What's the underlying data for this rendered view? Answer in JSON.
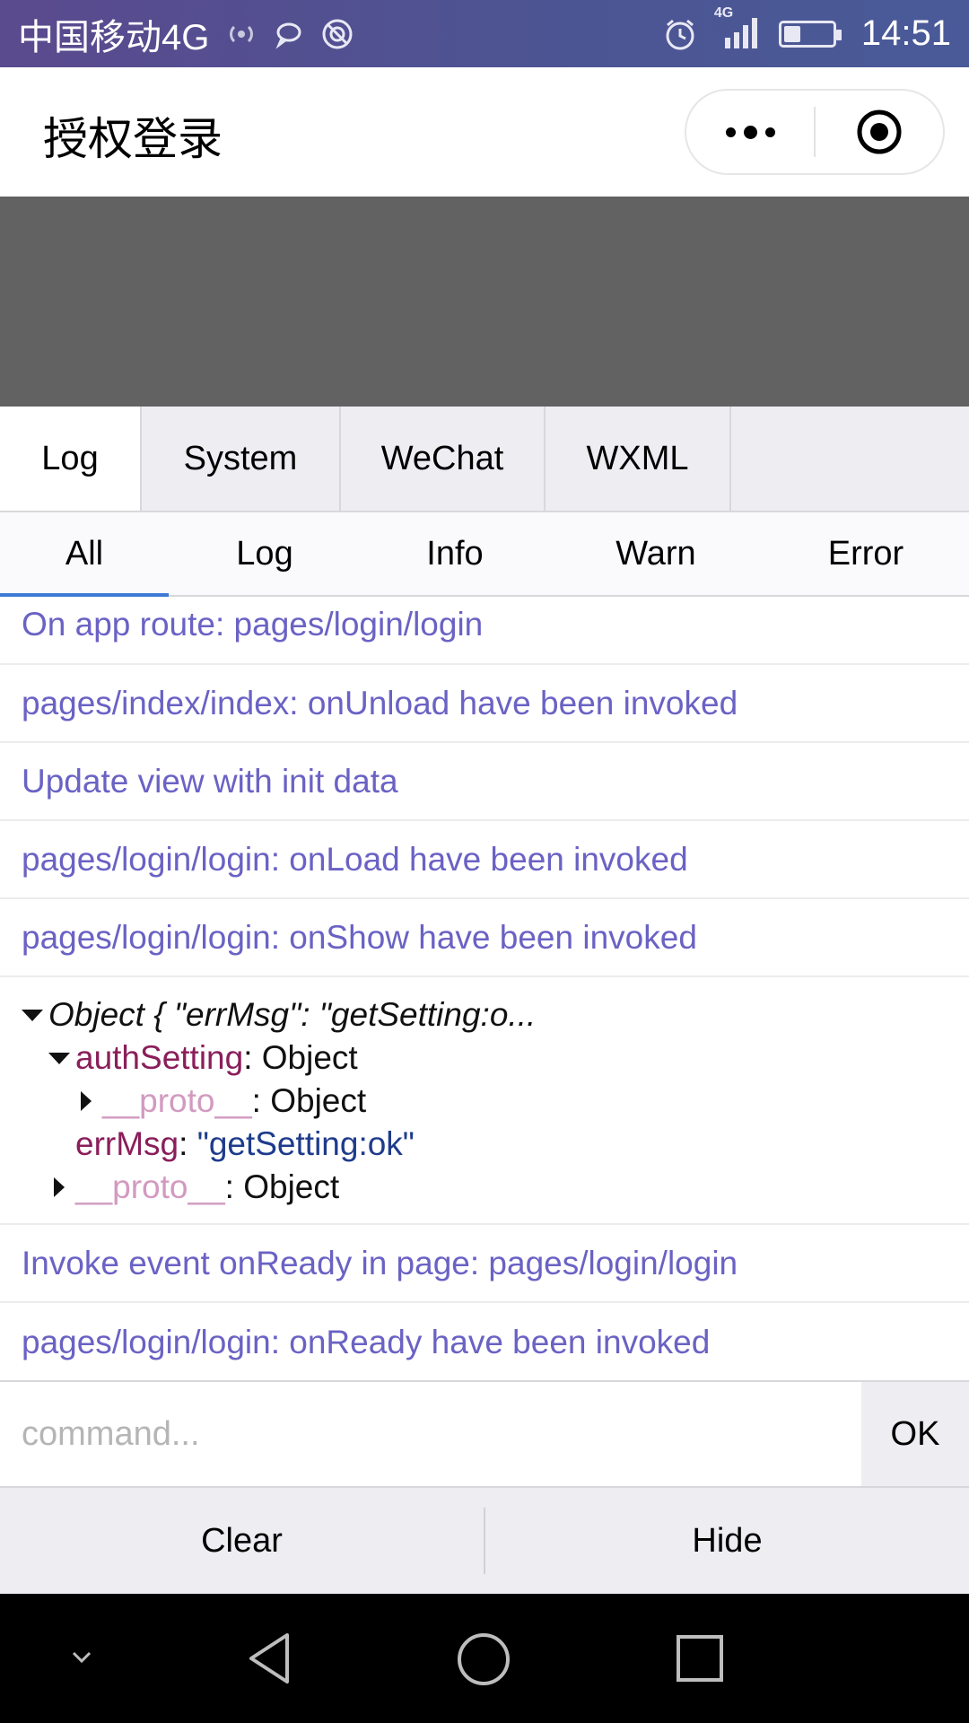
{
  "status_bar": {
    "carrier": "中国移动4G",
    "network_badge": "4G",
    "time": "14:51",
    "battery_level": 0.35,
    "icons": [
      "hotspot-icon",
      "message-icon",
      "app-icon",
      "alarm-icon",
      "signal-icon",
      "battery-icon"
    ]
  },
  "header": {
    "title": "授权登录",
    "menu_icon": "more-icon",
    "close_icon": "record-icon"
  },
  "console": {
    "tabs": [
      {
        "label": "Log",
        "active": true
      },
      {
        "label": "System"
      },
      {
        "label": "WeChat"
      },
      {
        "label": "WXML"
      }
    ],
    "filters": [
      {
        "label": "All",
        "active": true
      },
      {
        "label": "Log"
      },
      {
        "label": "Info"
      },
      {
        "label": "Warn"
      },
      {
        "label": "Error"
      }
    ],
    "logs": [
      "On app route: pages/login/login",
      "pages/index/index: onUnload have been invoked",
      "Update view with init data",
      "pages/login/login: onLoad have been invoked",
      "pages/login/login: onShow have been invoked"
    ],
    "object": {
      "summary": "Object { \"errMsg\": \"getSetting:o...",
      "authSetting_key": "authSetting",
      "authSetting_value": ": Object",
      "proto_key": "__proto__",
      "proto_value": ": Object",
      "errMsg_key": "errMsg",
      "errMsg_colon": ": ",
      "errMsg_value": "\"getSetting:ok\""
    },
    "logs_after": [
      "Invoke event onReady in page: pages/login/login",
      "pages/login/login: onReady have been invoked"
    ],
    "command_placeholder": "command...",
    "ok_label": "OK",
    "clear_label": "Clear",
    "hide_label": "Hide"
  },
  "nav_bar": {
    "icons": [
      "collapse-icon",
      "back-icon",
      "home-icon",
      "recents-icon"
    ]
  },
  "colors": {
    "status_bar": "#4c5593",
    "log_text": "#6a62c4",
    "active_filter": "#3d7ad6"
  }
}
